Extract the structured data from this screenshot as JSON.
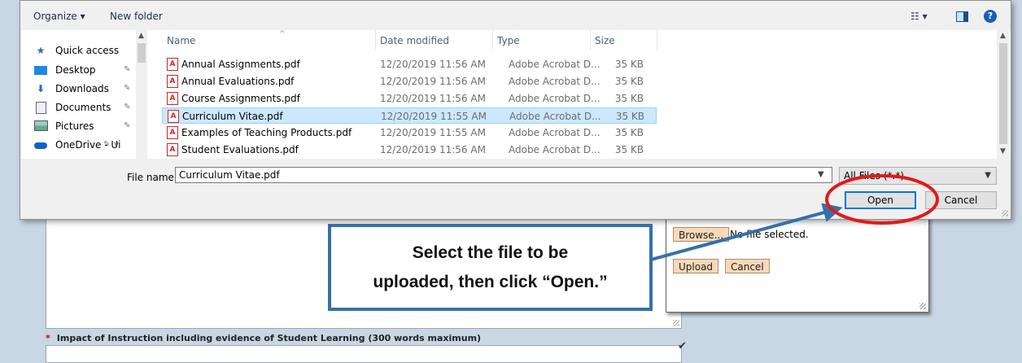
{
  "toolbar": {
    "organize_label": "Organize ▾",
    "new_folder_label": "New folder"
  },
  "nav": {
    "items": [
      {
        "label": "Quick access",
        "icon": "star-icon",
        "pinned": false
      },
      {
        "label": "Desktop",
        "icon": "desktop-icon",
        "pinned": true
      },
      {
        "label": "Downloads",
        "icon": "download-icon",
        "pinned": true
      },
      {
        "label": "Documents",
        "icon": "documents-icon",
        "pinned": true
      },
      {
        "label": "Pictures",
        "icon": "pictures-icon",
        "pinned": true
      },
      {
        "label": "OneDrive - Ui",
        "icon": "cloud-icon",
        "pinned": true
      }
    ]
  },
  "files": {
    "columns": {
      "name": "Name",
      "date": "Date modified",
      "type": "Type",
      "size": "Size"
    },
    "rows": [
      {
        "name": "Annual Assignments.pdf",
        "date": "12/20/2019 11:56 AM",
        "type": "Adobe Acrobat D...",
        "size": "35 KB",
        "selected": false
      },
      {
        "name": "Annual Evaluations.pdf",
        "date": "12/20/2019 11:56 AM",
        "type": "Adobe Acrobat D...",
        "size": "35 KB",
        "selected": false
      },
      {
        "name": "Course Assignments.pdf",
        "date": "12/20/2019 11:56 AM",
        "type": "Adobe Acrobat D...",
        "size": "35 KB",
        "selected": false
      },
      {
        "name": "Curriculum Vitae.pdf",
        "date": "12/20/2019 11:55 AM",
        "type": "Adobe Acrobat D...",
        "size": "35 KB",
        "selected": true
      },
      {
        "name": "Examples of Teaching Products.pdf",
        "date": "12/20/2019 11:55 AM",
        "type": "Adobe Acrobat D...",
        "size": "35 KB",
        "selected": false
      },
      {
        "name": "Student Evaluations.pdf",
        "date": "12/20/2019 11:56 AM",
        "type": "Adobe Acrobat D...",
        "size": "35 KB",
        "selected": false
      }
    ]
  },
  "filename": {
    "label": "File name:",
    "value": "Curriculum Vitae.pdf"
  },
  "filter": {
    "value": "All Files (*.*)"
  },
  "dialog_buttons": {
    "open_label": "Open",
    "cancel_label": "Cancel"
  },
  "upload": {
    "browse_label": "Browse...",
    "no_file_text": "No file selected.",
    "upload_label": "Upload",
    "cancel_label": "Cancel"
  },
  "page": {
    "question_marker": "*",
    "question_text": "Impact of Instruction including evidence of Student Learning (300 words maximum)"
  },
  "annotation": {
    "line1": "Select the file to be",
    "line2": "uploaded, then click “Open.”",
    "arrow_color": "#3670a8",
    "circle_color": "#e01b1b"
  },
  "colors": {
    "selection": "#cce8ff",
    "accent": "#0078d7",
    "web_button": "#f6d9b9"
  }
}
